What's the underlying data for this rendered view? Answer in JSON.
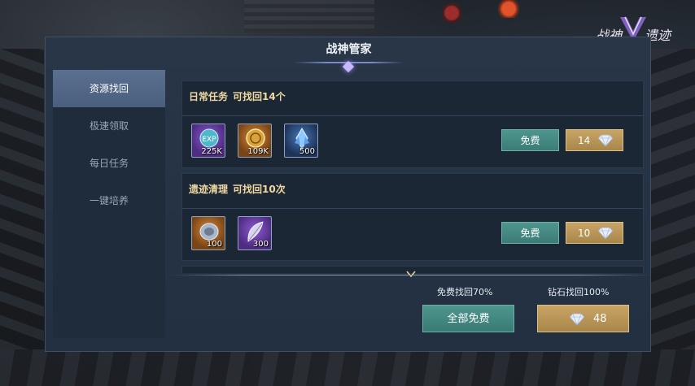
{
  "logo": {
    "left": "战神",
    "right": "遗迹"
  },
  "panel": {
    "title": "战神管家"
  },
  "nav": [
    {
      "label": "资源找回",
      "active": true
    },
    {
      "label": "极速领取",
      "active": false
    },
    {
      "label": "每日任务",
      "active": false
    },
    {
      "label": "一键培养",
      "active": false
    }
  ],
  "tasks": [
    {
      "name": "日常任务",
      "recover_text": "可找回14个",
      "items": [
        {
          "icon": "exp-orb-icon",
          "qty": "225K",
          "color": "purple"
        },
        {
          "icon": "gold-coin-icon",
          "qty": "109K",
          "color": "orange"
        },
        {
          "icon": "blue-crystal-icon",
          "qty": "500",
          "color": "blue"
        }
      ],
      "free_label": "免费",
      "diamond_cost": "14"
    },
    {
      "name": "遗迹清理",
      "recover_text": "可找回10次",
      "items": [
        {
          "icon": "silver-stone-icon",
          "qty": "100",
          "color": "orange"
        },
        {
          "icon": "feather-icon",
          "qty": "300",
          "color": "purple"
        }
      ],
      "free_label": "免费",
      "diamond_cost": "10"
    }
  ],
  "footer": {
    "free_rate_label": "免费找回70%",
    "diamond_rate_label": "钻石找回100%",
    "all_free_label": "全部免费",
    "all_diamond_cost": "48"
  },
  "colors": {
    "free_button": "#3c7c76",
    "diamond_button": "#a8864a",
    "nav_active": "#4a5f7e",
    "task_title": "#f0d9a0"
  }
}
